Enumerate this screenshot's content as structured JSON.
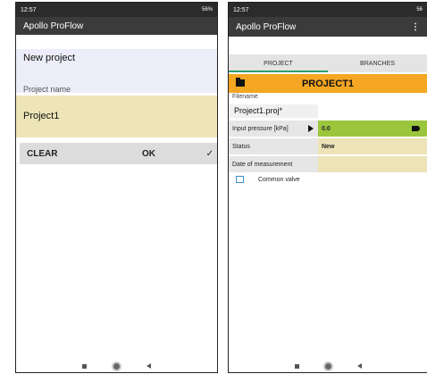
{
  "left": {
    "status_time": "12:57",
    "status_icons_right": "56%",
    "app_title": "Apollo ProFlow",
    "new_project": "New project",
    "project_name_label": "Project name",
    "project_name_value": "Project1",
    "clear_label": "CLEAR",
    "ok_label": "OK"
  },
  "right": {
    "status_time": "12:57",
    "status_icons_right": "56",
    "app_title": "Apollo ProFlow",
    "tabs": [
      "PROJECT",
      "BRANCHES"
    ],
    "header_title": "PROJECT1",
    "filename_label": "Filename",
    "filename_value": "Project1.proj*",
    "rows": [
      {
        "label": "Input pressure [kPa]",
        "value": "0.0"
      },
      {
        "label": "Status",
        "value": "New"
      },
      {
        "label": "Date of measurement",
        "value": ""
      }
    ],
    "checkbox_label": "Common valve"
  },
  "colors": {
    "accent_orange": "#f5a623",
    "input_yellow": "#ede5b8",
    "pressure_green": "#9bc53d",
    "tab_indicator": "#2e9e6e"
  }
}
